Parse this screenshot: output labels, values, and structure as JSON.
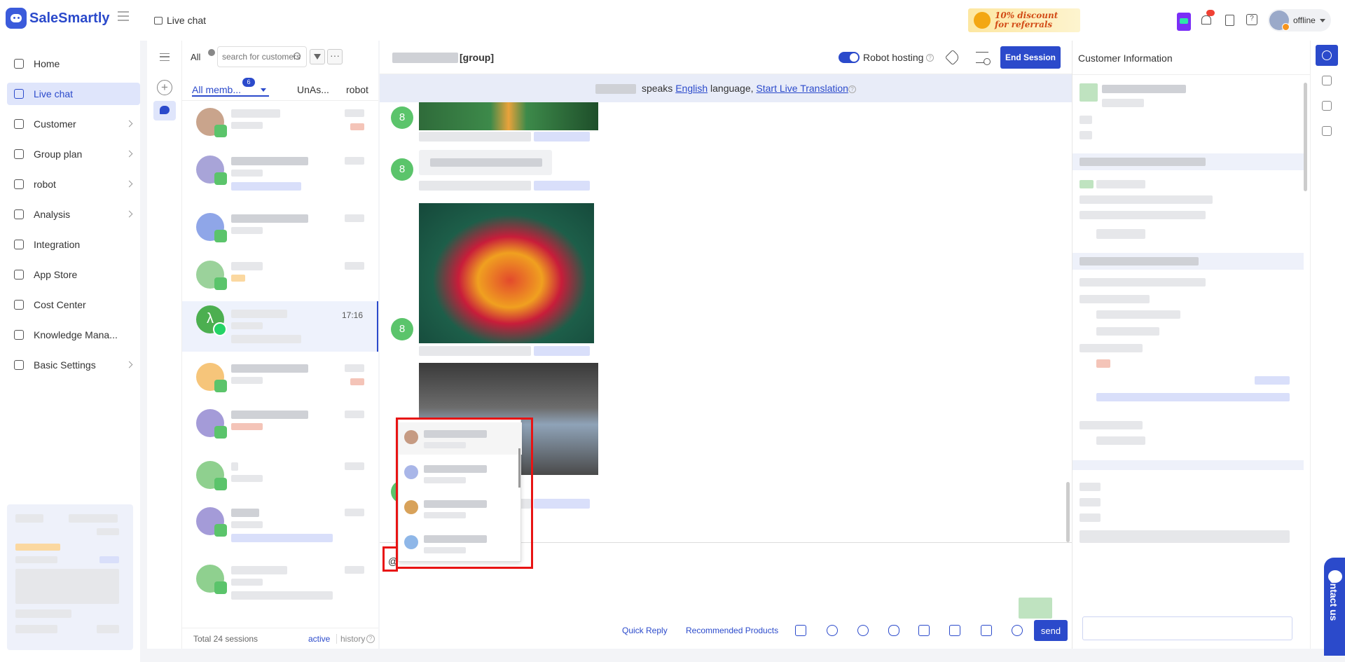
{
  "brand": {
    "name": "SaleSmartly"
  },
  "header": {
    "breadcrumb": "Live chat",
    "promo": {
      "line1": "10% discount",
      "line2": "for referrals"
    },
    "status": "offline"
  },
  "sidebar": {
    "items": [
      {
        "label": "Home",
        "icon": "home-icon",
        "has_children": false
      },
      {
        "label": "Live chat",
        "icon": "chat-icon",
        "has_children": false,
        "active": true
      },
      {
        "label": "Customer",
        "icon": "users-icon",
        "has_children": true
      },
      {
        "label": "Group plan",
        "icon": "send-icon",
        "has_children": true
      },
      {
        "label": "robot",
        "icon": "robot-icon",
        "has_children": true
      },
      {
        "label": "Analysis",
        "icon": "analysis-icon",
        "has_children": true
      },
      {
        "label": "Integration",
        "icon": "integration-icon",
        "has_children": false
      },
      {
        "label": "App Store",
        "icon": "grid-icon",
        "has_children": false
      },
      {
        "label": "Cost Center",
        "icon": "wallet-icon",
        "has_children": false
      },
      {
        "label": "Knowledge Mana...",
        "icon": "book-icon",
        "has_children": false
      },
      {
        "label": "Basic Settings",
        "icon": "gear-icon",
        "has_children": true
      }
    ]
  },
  "session_list": {
    "filter_label": "All",
    "search_placeholder": "search for customers",
    "tabs": [
      {
        "label": "All memb...",
        "badge": "6"
      },
      {
        "label": "UnAs..."
      },
      {
        "label": "robot"
      }
    ],
    "active_session_time": "17:16",
    "footer": {
      "total": "Total 24 sessions",
      "active": "active",
      "history": "history"
    }
  },
  "chat": {
    "group_tag": "[group]",
    "robot_hosting_label": "Robot hosting",
    "robot_hosting_on": true,
    "end_session_label": "End Session",
    "translation": {
      "text_1": "speaks",
      "language": "English",
      "text_2": "language,",
      "action": "Start Live Translation"
    },
    "avatar_initial": "8",
    "input_value": "@"
  },
  "toolbar": {
    "quick_reply": "Quick Reply",
    "recommended_products": "Recommended Products",
    "icons": [
      "contact-card-icon",
      "mention-icon",
      "emoji-icon",
      "microphone-icon",
      "file-icon",
      "image-icon",
      "video-icon",
      "link-icon"
    ],
    "send_label": "send"
  },
  "customer_info": {
    "title": "Customer Information"
  },
  "contact_us": {
    "label": "Contact us"
  },
  "colors": {
    "accent": "#2b4acb",
    "highlight": "#e81414",
    "avatar_green": "#5bc46b"
  }
}
